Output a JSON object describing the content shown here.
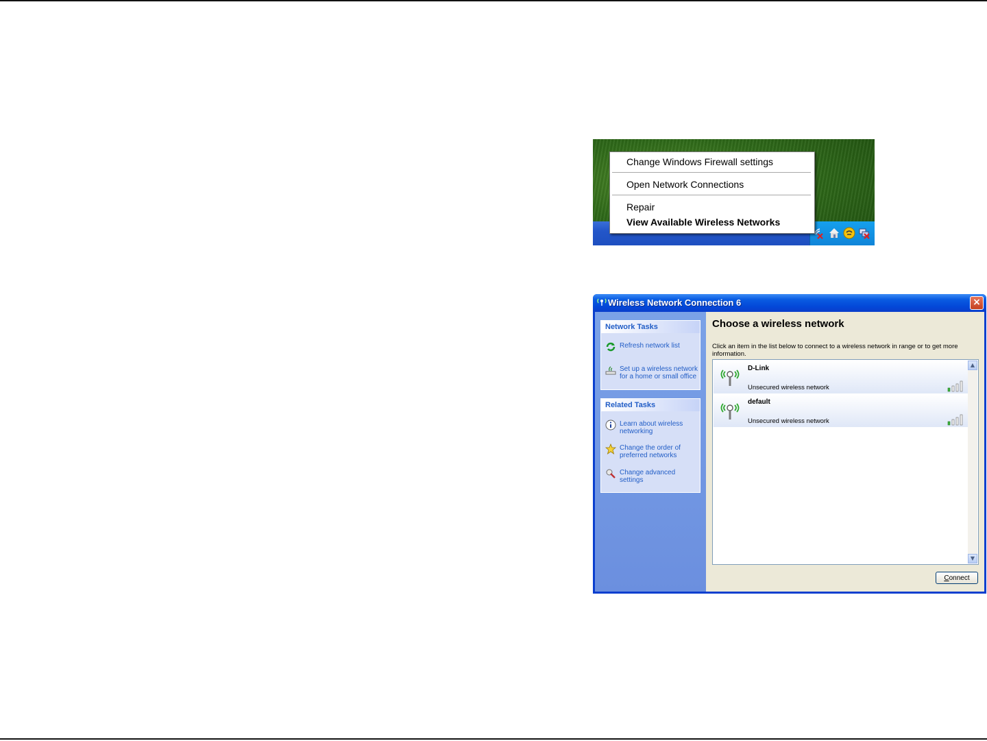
{
  "context_menu": {
    "items": [
      {
        "label": "Change Windows Firewall settings",
        "bold": false
      },
      {
        "label": "Open Network Connections",
        "bold": false
      },
      {
        "label": "Repair",
        "bold": false
      },
      {
        "label": "View Available Wireless Networks",
        "bold": true
      }
    ]
  },
  "tray_icons": [
    "wireless-disconnected-icon",
    "home-icon",
    "security-alert-icon",
    "network-disconnected-icon"
  ],
  "window": {
    "title": "Wireless Network Connection 6",
    "close_label": "×",
    "network_tasks": {
      "header": "Network Tasks",
      "items": [
        {
          "label": "Refresh network list",
          "icon": "refresh-icon"
        },
        {
          "label": "Set up a wireless network for a home or small office",
          "icon": "setup-network-icon"
        }
      ]
    },
    "related_tasks": {
      "header": "Related Tasks",
      "items": [
        {
          "label": "Learn about wireless networking",
          "icon": "info-icon"
        },
        {
          "label": "Change the order of preferred networks",
          "icon": "star-icon"
        },
        {
          "label": "Change advanced settings",
          "icon": "settings-icon"
        }
      ]
    },
    "main_title": "Choose a wireless network",
    "description": "Click an item in the list below to connect to a wireless network in range or to get more information.",
    "networks": [
      {
        "name": "D-Link",
        "status": "Unsecured wireless network",
        "signal_bars": 4
      },
      {
        "name": "default",
        "status": "Unsecured wireless network",
        "signal_bars": 4
      }
    ],
    "connect_prefix": "C",
    "connect_rest": "onnect"
  },
  "colors": {
    "xp_blue": "#0a3fcf",
    "task_link": "#215dc6",
    "signal_green": "#3cb43c"
  }
}
